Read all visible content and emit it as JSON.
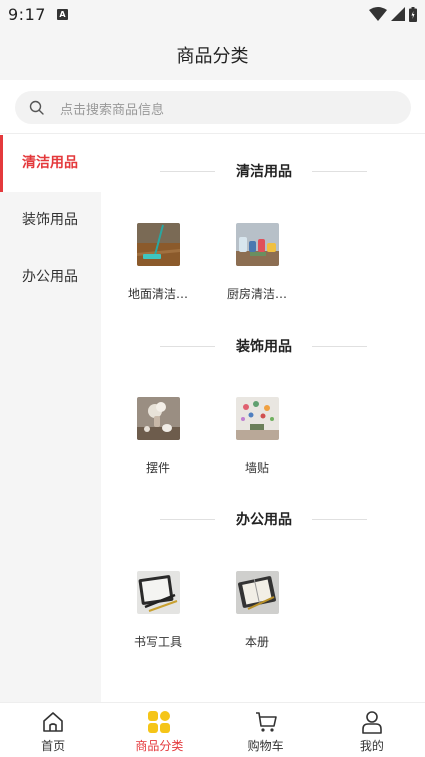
{
  "status": {
    "time": "9:17",
    "notification_letter": "A"
  },
  "header": {
    "title": "商品分类"
  },
  "search": {
    "placeholder": "点击搜索商品信息"
  },
  "sidebar": {
    "items": [
      {
        "label": "清洁用品",
        "active": true
      },
      {
        "label": "装饰用品",
        "active": false
      },
      {
        "label": "办公用品",
        "active": false
      }
    ]
  },
  "sections": [
    {
      "title": "清洁用品",
      "products": [
        {
          "name": "地面清洁…"
        },
        {
          "name": "厨房清洁…"
        }
      ]
    },
    {
      "title": "装饰用品",
      "products": [
        {
          "name": "摆件"
        },
        {
          "name": "墙贴"
        }
      ]
    },
    {
      "title": "办公用品",
      "products": [
        {
          "name": "书写工具"
        },
        {
          "name": "本册"
        }
      ]
    }
  ],
  "tabbar": {
    "items": [
      {
        "label": "首页",
        "icon": "home-icon"
      },
      {
        "label": "商品分类",
        "icon": "category-icon",
        "active": true
      },
      {
        "label": "购物车",
        "icon": "cart-icon"
      },
      {
        "label": "我的",
        "icon": "profile-icon"
      }
    ]
  },
  "colors": {
    "accent": "#e4393c",
    "active_icon": "#f5c518"
  }
}
